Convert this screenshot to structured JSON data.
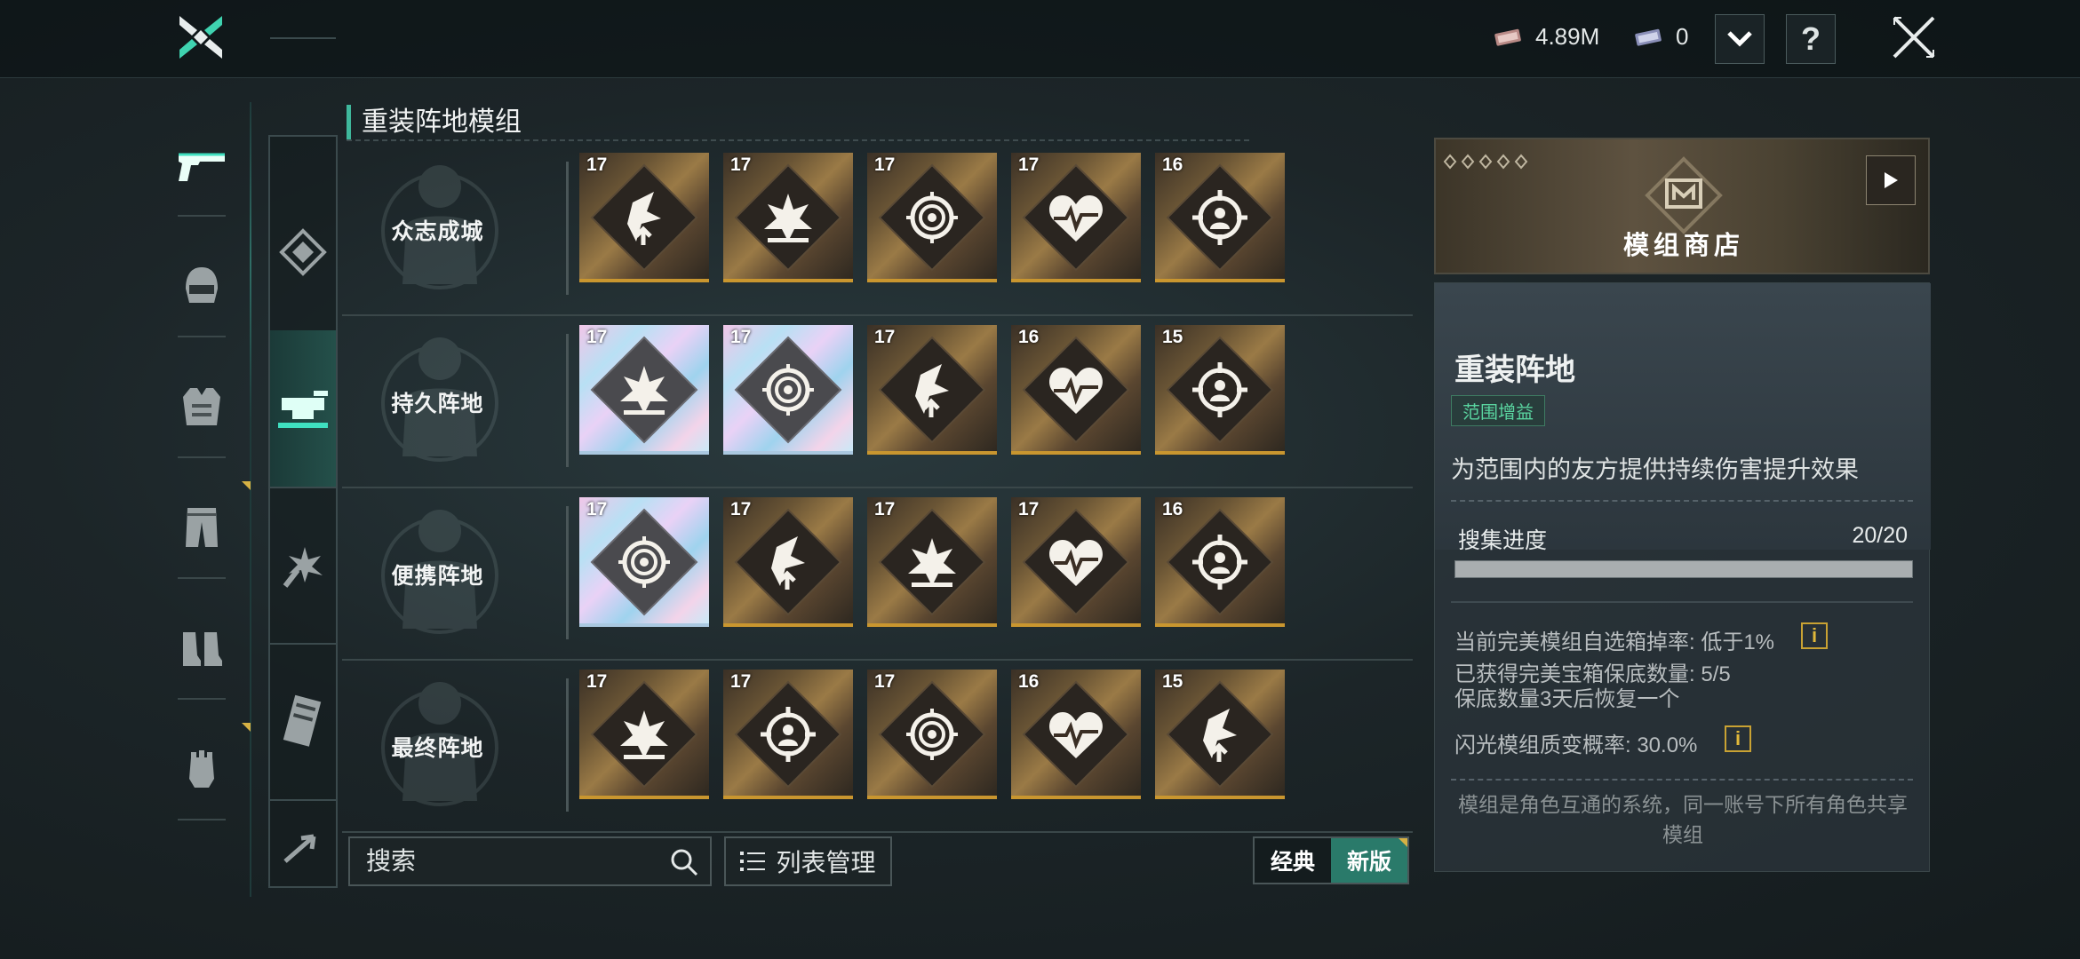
{
  "topbar": {
    "currency1_value": "4.89M",
    "currency2_value": "0",
    "help_label": "?"
  },
  "section_title": "重装阵地模组",
  "rows": [
    {
      "label": "众志成城",
      "cards": [
        {
          "level": "17",
          "icon": "arrow-burst-icon",
          "holo": false
        },
        {
          "level": "17",
          "icon": "explosion-icon",
          "holo": false
        },
        {
          "level": "17",
          "icon": "target-rings-icon",
          "holo": false
        },
        {
          "level": "17",
          "icon": "heartbeat-icon",
          "holo": false
        },
        {
          "level": "16",
          "icon": "crosshair-person-icon",
          "holo": false
        }
      ]
    },
    {
      "label": "持久阵地",
      "cards": [
        {
          "level": "17",
          "icon": "explosion-icon",
          "holo": true
        },
        {
          "level": "17",
          "icon": "target-rings-icon",
          "holo": true
        },
        {
          "level": "17",
          "icon": "arrow-burst-icon",
          "holo": false
        },
        {
          "level": "16",
          "icon": "heartbeat-icon",
          "holo": false
        },
        {
          "level": "15",
          "icon": "crosshair-person-icon",
          "holo": false
        }
      ]
    },
    {
      "label": "便携阵地",
      "cards": [
        {
          "level": "17",
          "icon": "target-rings-icon",
          "holo": true
        },
        {
          "level": "17",
          "icon": "arrow-burst-icon",
          "holo": false
        },
        {
          "level": "17",
          "icon": "explosion-icon",
          "holo": false
        },
        {
          "level": "17",
          "icon": "heartbeat-icon",
          "holo": false
        },
        {
          "level": "16",
          "icon": "crosshair-person-icon",
          "holo": false
        }
      ]
    },
    {
      "label": "最终阵地",
      "cards": [
        {
          "level": "17",
          "icon": "explosion-icon",
          "holo": false
        },
        {
          "level": "17",
          "icon": "crosshair-person-icon",
          "holo": false
        },
        {
          "level": "17",
          "icon": "target-rings-icon",
          "holo": false
        },
        {
          "level": "16",
          "icon": "heartbeat-icon",
          "holo": false
        },
        {
          "level": "15",
          "icon": "arrow-burst-icon",
          "holo": false
        }
      ]
    }
  ],
  "search": {
    "placeholder": "搜索"
  },
  "list_manage_label": "列表管理",
  "toggle": {
    "classic": "经典",
    "new": "新版"
  },
  "shop": {
    "label": "模组商店"
  },
  "detail": {
    "title": "重装阵地",
    "tag": "范围增益",
    "description": "为范围内的友方提供持续伤害提升效果",
    "progress_label": "搜集进度",
    "progress_value": "20/20",
    "progress_fraction": 1.0,
    "drop_rate": "当前完美模组自选箱掉率: 低于1%",
    "pity_count": "已获得完美宝箱保底数量: 5/5",
    "pity_recover": "保底数量3天后恢复一个",
    "flash_rate": "闪光模组质变概率: 30.0%",
    "footer": "模组是角色互通的系统，同一账号下所有角色共享模组"
  },
  "colors": {
    "accent": "#3fb89c",
    "gold": "#c9962f",
    "toggle_on": "#2a7a6a"
  }
}
